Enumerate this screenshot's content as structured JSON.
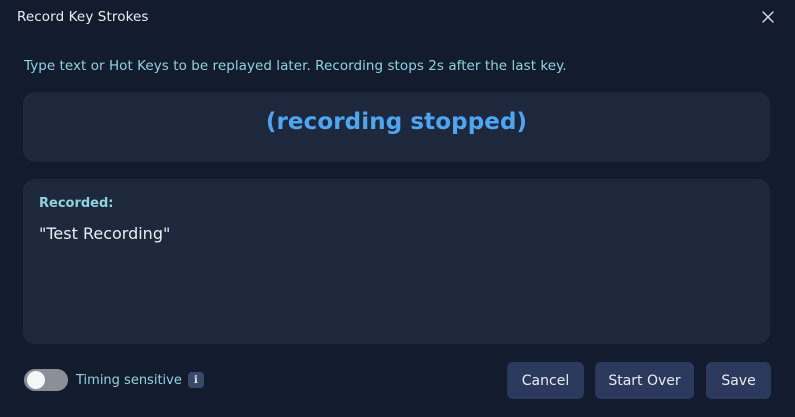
{
  "dialog": {
    "title": "Record Key Strokes",
    "instructions": "Type text or Hot Keys to be replayed later. Recording stops 2s after the last key.",
    "status": "(recording stopped)",
    "recorded_label": "Recorded:",
    "recorded_value": "\"Test Recording\"",
    "timing_label": "Timing sensitive",
    "timing_enabled": false,
    "info_glyph": "i",
    "buttons": {
      "cancel": "Cancel",
      "start_over": "Start Over",
      "save": "Save"
    }
  },
  "colors": {
    "background": "#131c2e",
    "panel": "#1d283d",
    "accent_text": "#8fd3df",
    "status_blue": "#4fa6f0",
    "button": "#2b3a5c"
  },
  "icons": {
    "close": "close-icon",
    "info": "info-icon"
  }
}
